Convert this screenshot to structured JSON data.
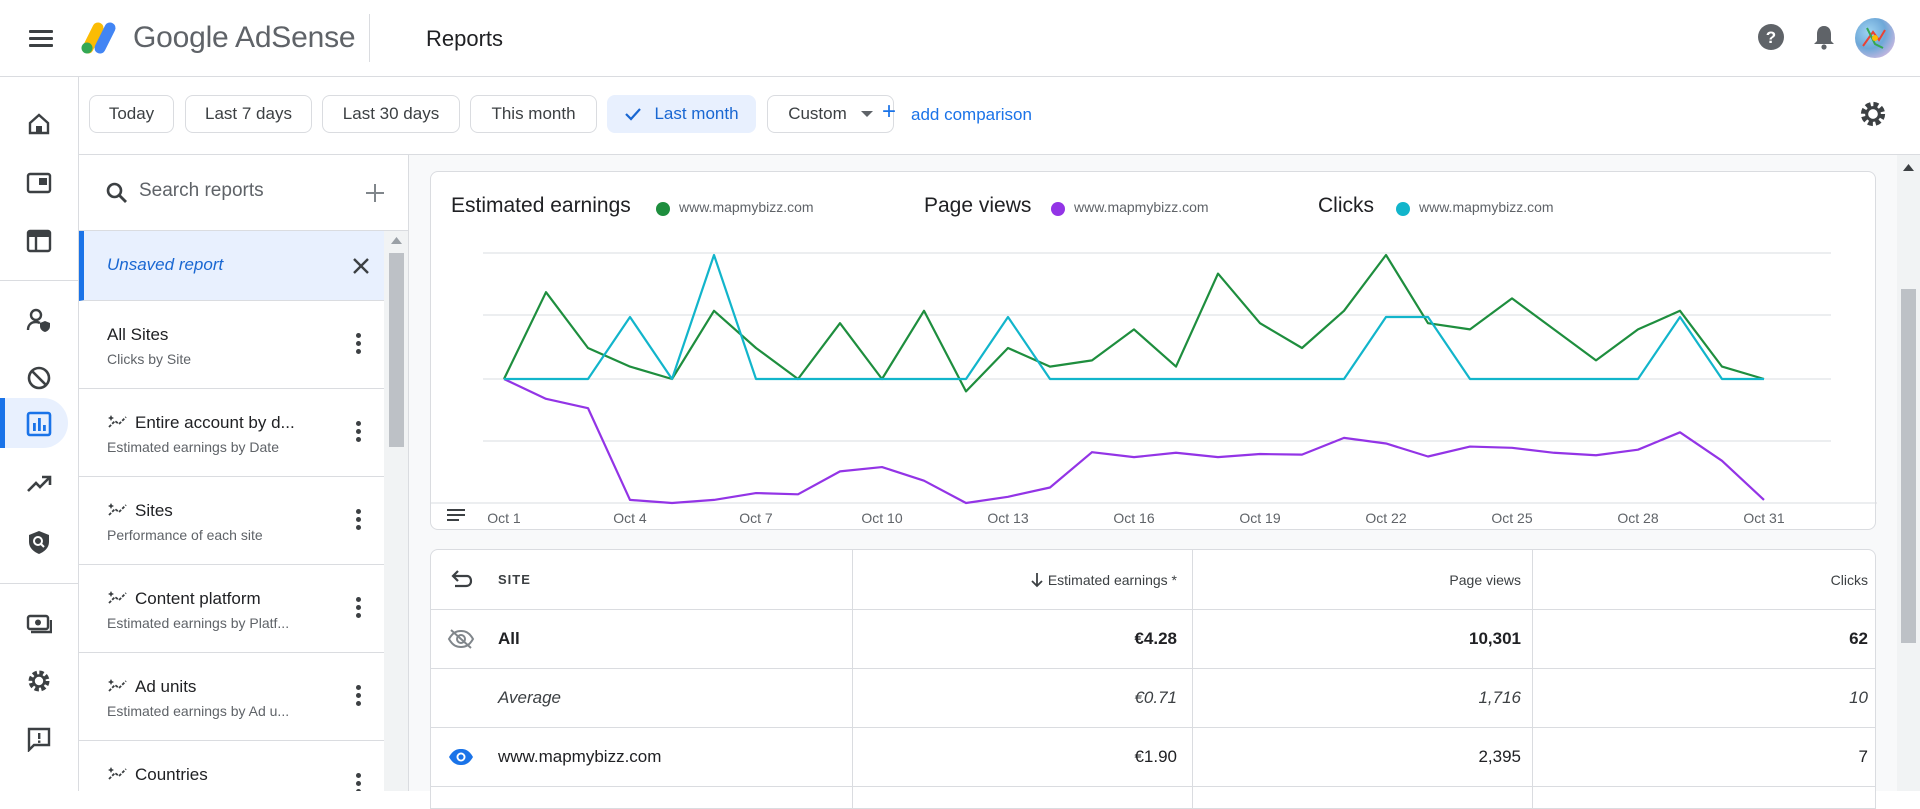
{
  "app": {
    "brand": "Google AdSense",
    "page_title": "Reports"
  },
  "filters": {
    "chips": [
      "Today",
      "Last 7 days",
      "Last 30 days",
      "This month",
      "Last month",
      "Custom"
    ],
    "selected": "Last month",
    "add_comparison": "add comparison"
  },
  "reports_panel": {
    "search_placeholder": "Search reports",
    "unsaved": "Unsaved report",
    "items": [
      {
        "title": "All Sites",
        "subtitle": "Clicks by Site"
      },
      {
        "title": "Entire account by d...",
        "subtitle": "Estimated earnings by Date"
      },
      {
        "title": "Sites",
        "subtitle": "Performance of each site"
      },
      {
        "title": "Content platform",
        "subtitle": "Estimated earnings by Platf..."
      },
      {
        "title": "Ad units",
        "subtitle": "Estimated earnings by Ad u..."
      },
      {
        "title": "Countries",
        "subtitle": ""
      }
    ]
  },
  "chart": {
    "metrics": [
      {
        "name": "Estimated earnings",
        "site": "www.mapmybizz.com",
        "color": "#1e8e3e"
      },
      {
        "name": "Page views",
        "site": "www.mapmybizz.com",
        "color": "#9334e6"
      },
      {
        "name": "Clicks",
        "site": "www.mapmybizz.com",
        "color": "#12b5cb"
      }
    ]
  },
  "chart_data": {
    "type": "line",
    "x": [
      "Oct 1",
      "Oct 2",
      "Oct 3",
      "Oct 4",
      "Oct 5",
      "Oct 6",
      "Oct 7",
      "Oct 8",
      "Oct 9",
      "Oct 10",
      "Oct 11",
      "Oct 12",
      "Oct 13",
      "Oct 14",
      "Oct 15",
      "Oct 16",
      "Oct 17",
      "Oct 18",
      "Oct 19",
      "Oct 20",
      "Oct 21",
      "Oct 22",
      "Oct 23",
      "Oct 24",
      "Oct 25",
      "Oct 26",
      "Oct 27",
      "Oct 28",
      "Oct 29",
      "Oct 30",
      "Oct 31"
    ],
    "x_ticks": [
      "Oct 1",
      "Oct 4",
      "Oct 7",
      "Oct 10",
      "Oct 13",
      "Oct 16",
      "Oct 19",
      "Oct 22",
      "Oct 25",
      "Oct 28",
      "Oct 31"
    ],
    "series": [
      {
        "name": "Estimated earnings",
        "color": "#1e8e3e",
        "values": [
          0,
          0.14,
          0.05,
          0.02,
          0,
          0.11,
          0.05,
          0,
          0.09,
          0,
          0.11,
          -0.02,
          0.05,
          0.02,
          0.03,
          0.08,
          0.02,
          0.17,
          0.09,
          0.05,
          0.11,
          0.2,
          0.09,
          0.08,
          0.13,
          0.08,
          0.03,
          0.08,
          0.11,
          0.02,
          0
        ]
      },
      {
        "name": "Page views",
        "color": "#9334e6",
        "values": [
          0,
          -32,
          -47,
          -195,
          -200,
          -195,
          -184,
          -186,
          -149,
          -142,
          -164,
          -200,
          -190,
          -175,
          -118,
          -126,
          -119,
          -126,
          -121,
          -122,
          -95,
          -104,
          -125,
          -109,
          -111,
          -119,
          -123,
          -114,
          -86,
          -132,
          -195
        ]
      },
      {
        "name": "Clicks",
        "color": "#12b5cb",
        "values": [
          0,
          0,
          0,
          1,
          0,
          2,
          0,
          0,
          0,
          0,
          0,
          0,
          1,
          0,
          0,
          0,
          0,
          0,
          0,
          0,
          0,
          1,
          1,
          0,
          0,
          0,
          0,
          0,
          1,
          0,
          0
        ]
      }
    ]
  },
  "table": {
    "headers": {
      "site": "SITE",
      "earnings": "Estimated earnings *",
      "pageviews": "Page views",
      "clicks": "Clicks"
    },
    "rows": [
      {
        "site": "All",
        "earnings": "€4.28",
        "pageviews": "10,301",
        "clicks": "62"
      },
      {
        "site": "Average",
        "earnings": "€0.71",
        "pageviews": "1,716",
        "clicks": "10"
      },
      {
        "site": "www.mapmybizz.com",
        "earnings": "€1.90",
        "pageviews": "2,395",
        "clicks": "7"
      }
    ]
  }
}
